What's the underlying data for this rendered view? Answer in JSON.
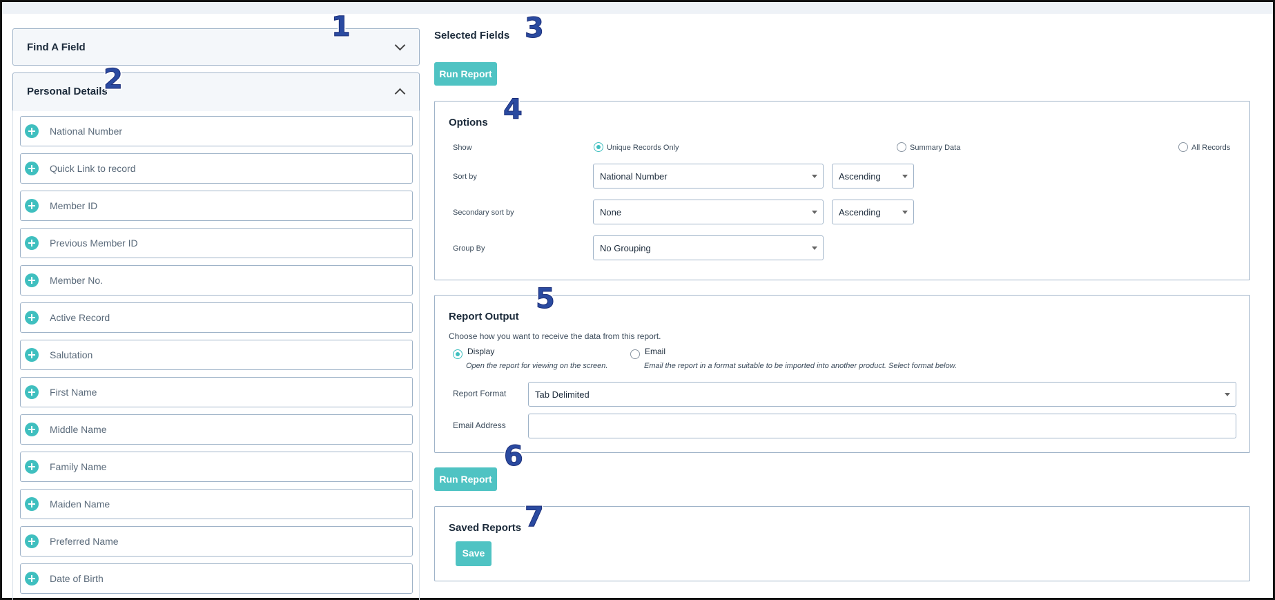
{
  "left": {
    "find_field": {
      "title": "Find A Field"
    },
    "personal_details": {
      "title": "Personal Details",
      "fields": [
        "National Number",
        "Quick Link to record",
        "Member ID",
        "Previous Member ID",
        "Member No.",
        "Active Record",
        "Salutation",
        "First Name",
        "Middle Name",
        "Family Name",
        "Maiden Name",
        "Preferred Name",
        "Date of Birth"
      ]
    }
  },
  "right": {
    "selected_fields_title": "Selected Fields",
    "run_report_label": "Run Report",
    "options": {
      "title": "Options",
      "show_label": "Show",
      "show_choices": [
        "Unique Records Only",
        "Summary Data",
        "All Records"
      ],
      "show_selected": "Unique Records Only",
      "sort_by_label": "Sort by",
      "sort_by_value": "National Number",
      "sort_order_value": "Ascending",
      "secondary_sort_label": "Secondary sort by",
      "secondary_sort_value": "None",
      "secondary_order_value": "Ascending",
      "group_by_label": "Group By",
      "group_by_value": "No Grouping"
    },
    "output": {
      "title": "Report Output",
      "intro": "Choose how you want to receive the data from this report.",
      "display_label": "Display",
      "display_desc": "Open the report for viewing on the screen.",
      "email_label": "Email",
      "email_desc": "Email the report in a format suitable to be imported into another product. Select format below.",
      "format_label": "Report Format",
      "format_value": "Tab Delimited",
      "email_address_label": "Email Address",
      "email_address_value": ""
    },
    "saved": {
      "title": "Saved Reports",
      "save_label": "Save"
    }
  },
  "annotations": [
    "1",
    "2",
    "3",
    "4",
    "5",
    "6",
    "7"
  ],
  "colors": {
    "accent": "#4fc3c3",
    "border": "#9fb3c8",
    "annotation": "#2a4aa0"
  }
}
